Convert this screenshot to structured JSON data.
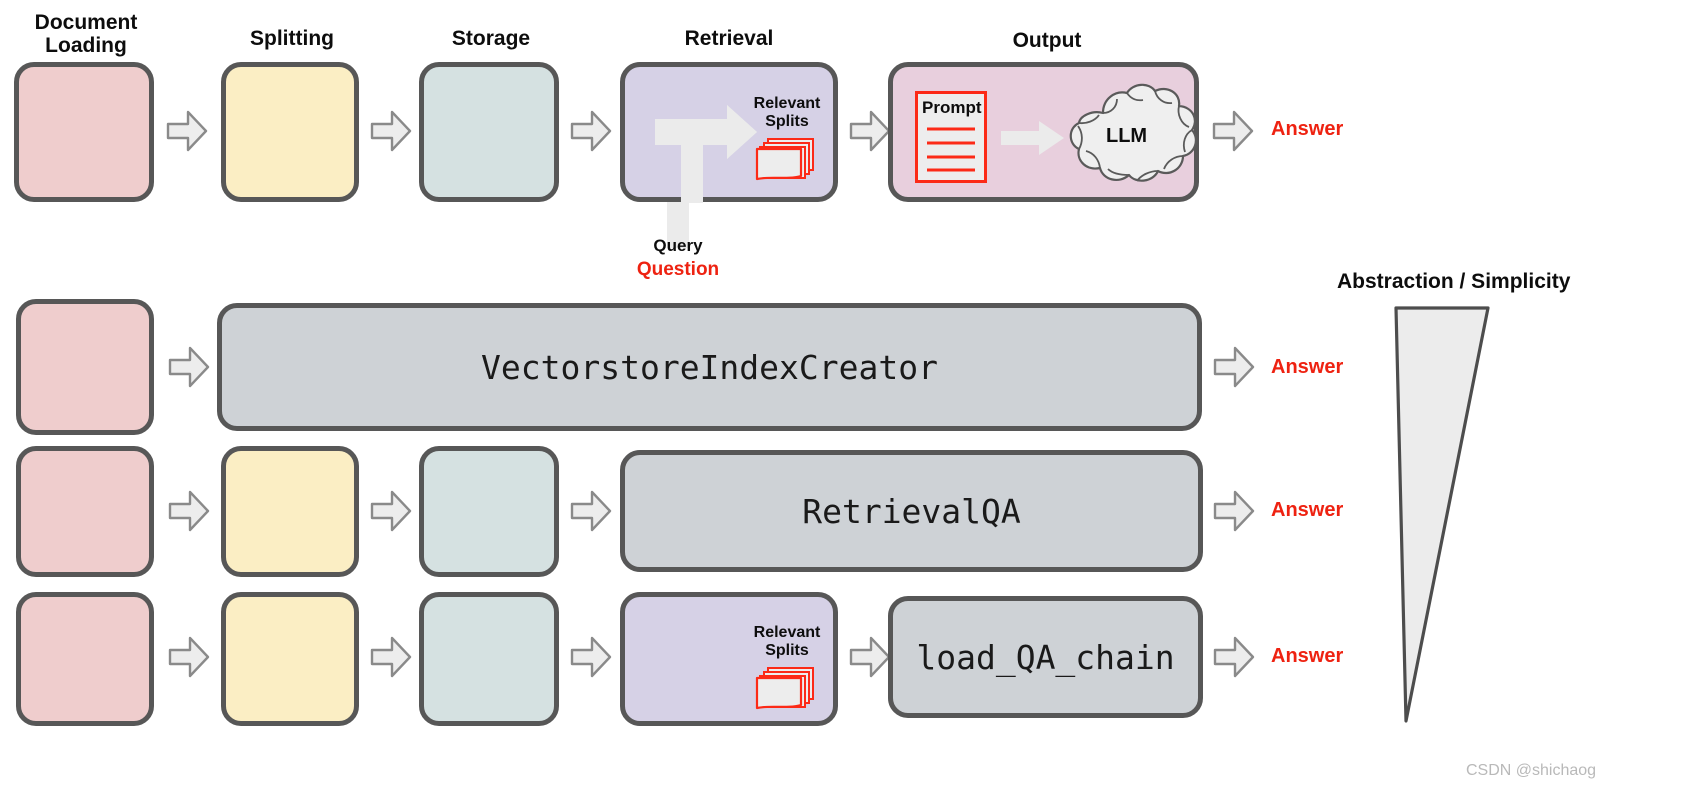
{
  "stages": {
    "document_loading": "Document\nLoading",
    "splitting": "Splitting",
    "storage": "Storage",
    "retrieval": "Retrieval",
    "output": "Output"
  },
  "retrieval_box": {
    "splits_label": "Relevant\nSplits",
    "splits_icon": "stacked-documents-icon"
  },
  "output_box": {
    "prompt_label": "Prompt",
    "prompt_icon": "prompt-document-icon",
    "llm_label": "LLM",
    "llm_icon": "cloud-icon"
  },
  "query": {
    "query_label": "Query",
    "question_label": "Question"
  },
  "answers": {
    "row1": "Answer",
    "row2": "Answer",
    "row3": "Answer",
    "row4": "Answer"
  },
  "chains": {
    "row2": "VectorstoreIndexCreator",
    "row3": "RetrievalQA",
    "row4": "load_QA_chain"
  },
  "abstraction": {
    "title": "Abstraction / Simplicity",
    "shape": "wedge-triangle"
  },
  "watermark": "CSDN @shichaog",
  "colors": {
    "pink": "#efcdcd",
    "cream": "#fbeec4",
    "teal": "#d5e1e1",
    "purple": "#d6d1e6",
    "gray": "#ced2d6",
    "border": "#575757",
    "accent_red": "#ee2211",
    "arrow_fill": "#ededed",
    "arrow_stroke": "#8a8a8a"
  }
}
